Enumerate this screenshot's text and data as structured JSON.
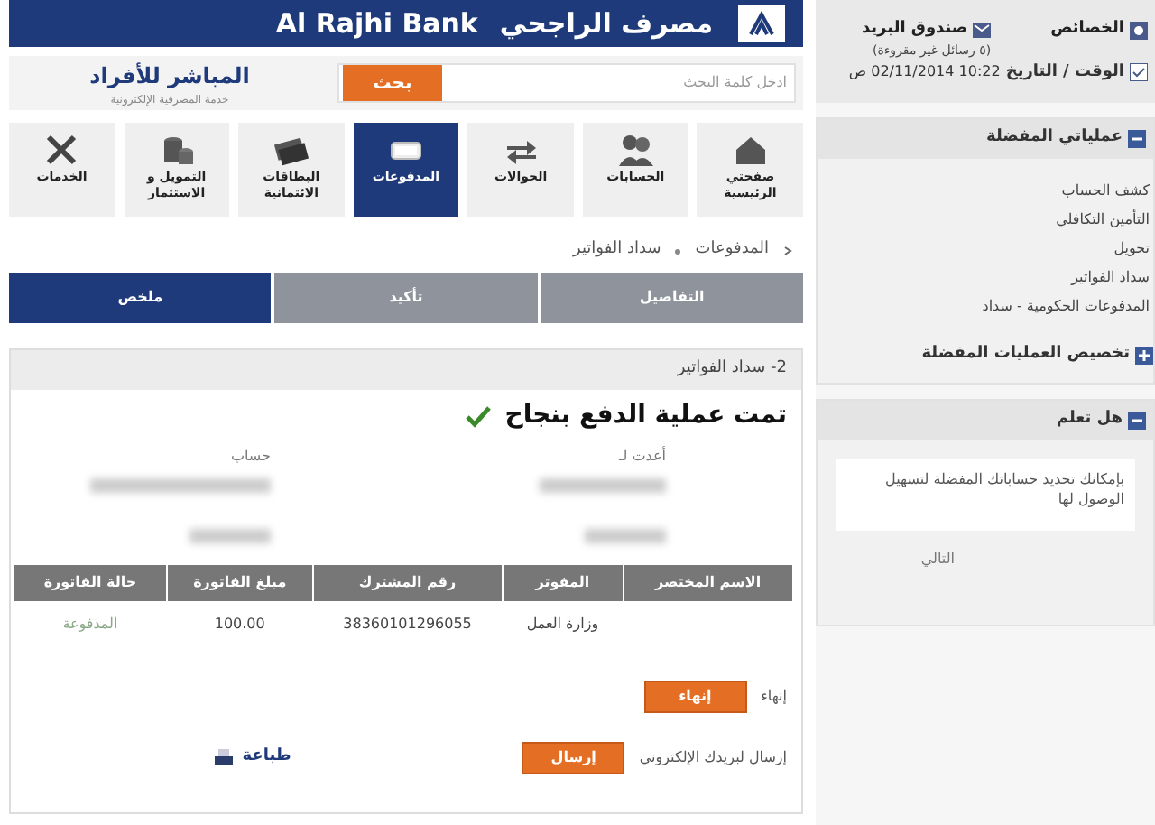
{
  "header": {
    "bank_name_ar": "مصرف الراجحي",
    "bank_name_en": "Al Rajhi Bank"
  },
  "brand": {
    "title": "المباشر للأفراد",
    "subtitle": "خدمة المصرفية الإلكترونية"
  },
  "search": {
    "placeholder": "ادخل كلمة البحث",
    "button": "بحث"
  },
  "nav_tiles": [
    {
      "label": "صفحتي الرئيسية",
      "selected": false
    },
    {
      "label": "الحسابات",
      "selected": false
    },
    {
      "label": "الحوالات",
      "selected": false
    },
    {
      "label": "المدفوعات",
      "selected": true
    },
    {
      "label": "البطاقات الائتمانية",
      "selected": false
    },
    {
      "label": "التمويل و الاستثمار",
      "selected": false
    },
    {
      "label": "الخدمات",
      "selected": false
    }
  ],
  "breadcrumb": [
    "المدفوعات",
    "سداد الفواتير"
  ],
  "steps": [
    {
      "label": "التفاصيل",
      "selected": false
    },
    {
      "label": "تأكيد",
      "selected": false
    },
    {
      "label": "ملخص",
      "selected": true
    }
  ],
  "panel": {
    "title": "2- سداد الفواتير",
    "success_message": "تمت عملية الدفع بنجاح",
    "details": [
      {
        "label": "أعدت لـ"
      },
      {
        "label": "حساب"
      }
    ],
    "table": {
      "columns": [
        "الاسم المختصر",
        "المفوتر",
        "رقم المشترك",
        "مبلغ الفاتورة",
        "حالة الفاتورة"
      ],
      "rows": [
        {
          "biller": "وزارة العمل",
          "subscriber_number": "38360101296055",
          "amount": "100.00",
          "status": "المدفوعة"
        }
      ]
    },
    "actions": [
      {
        "label": "إنهاء",
        "button": "إنهاء"
      },
      {
        "label": "إرسال لبريدك الإلكتروني",
        "button": "إرسال"
      }
    ],
    "print_link": "طباعة"
  },
  "sidebar": {
    "properties": "الخصائص",
    "mailbox": "صندوق البريد",
    "unread": "(٥ رسائل غير مقروءة)",
    "datetime_label": "الوقت / التاريخ",
    "datetime": "10:22 02/11/2014 ص",
    "favorites": {
      "title": "عملياتي المفضلة",
      "expanded": true,
      "items": [
        "كشف الحساب",
        "التأمين التكافلي",
        "تحويل",
        "سداد الفواتير",
        "المدفوعات الحكومية - سداد"
      ],
      "customize": "تخصيص العمليات المفضلة"
    },
    "tips": {
      "title": "هل تعلم",
      "expanded": true,
      "text": "بإمكانك تحديد حساباتك المفضلة لتسهيل الوصول لها",
      "next": "التالي"
    }
  }
}
